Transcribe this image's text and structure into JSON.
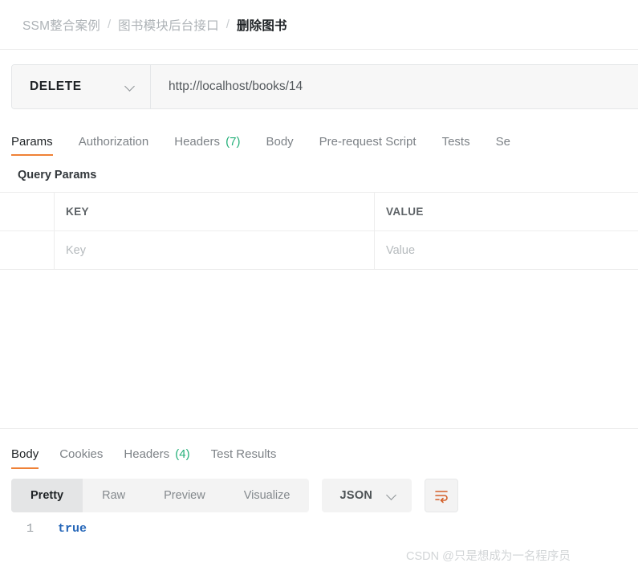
{
  "breadcrumb": {
    "items": [
      {
        "label": "SSM整合案例",
        "current": false
      },
      {
        "label": "图书模块后台接口",
        "current": false
      },
      {
        "label": "删除图书",
        "current": true
      }
    ],
    "separator": "/"
  },
  "request": {
    "method": "DELETE",
    "url": "http://localhost/books/14",
    "tabs": [
      {
        "label": "Params",
        "count": null,
        "active": true
      },
      {
        "label": "Authorization",
        "count": null,
        "active": false
      },
      {
        "label": "Headers",
        "count": "(7)",
        "active": false
      },
      {
        "label": "Body",
        "count": null,
        "active": false
      },
      {
        "label": "Pre-request Script",
        "count": null,
        "active": false
      },
      {
        "label": "Tests",
        "count": null,
        "active": false
      },
      {
        "label": "Se",
        "count": null,
        "active": false
      }
    ]
  },
  "query_params": {
    "title": "Query Params",
    "headers": {
      "key": "KEY",
      "value": "VALUE"
    },
    "rows": [
      {
        "key_placeholder": "Key",
        "value_placeholder": "Value"
      }
    ]
  },
  "response": {
    "tabs": [
      {
        "label": "Body",
        "count": null,
        "active": true
      },
      {
        "label": "Cookies",
        "count": null,
        "active": false
      },
      {
        "label": "Headers",
        "count": "(4)",
        "active": false
      },
      {
        "label": "Test Results",
        "count": null,
        "active": false
      }
    ],
    "format_modes": [
      {
        "label": "Pretty",
        "active": true
      },
      {
        "label": "Raw",
        "active": false
      },
      {
        "label": "Preview",
        "active": false
      },
      {
        "label": "Visualize",
        "active": false
      }
    ],
    "language": "JSON",
    "body_lines": [
      {
        "number": "1",
        "text": "true"
      }
    ]
  },
  "watermark": "CSDN @只是想成为一名程序员",
  "colors": {
    "accent_orange": "#ef8136",
    "badge_green": "#25b07a",
    "code_blue": "#2566b8"
  }
}
